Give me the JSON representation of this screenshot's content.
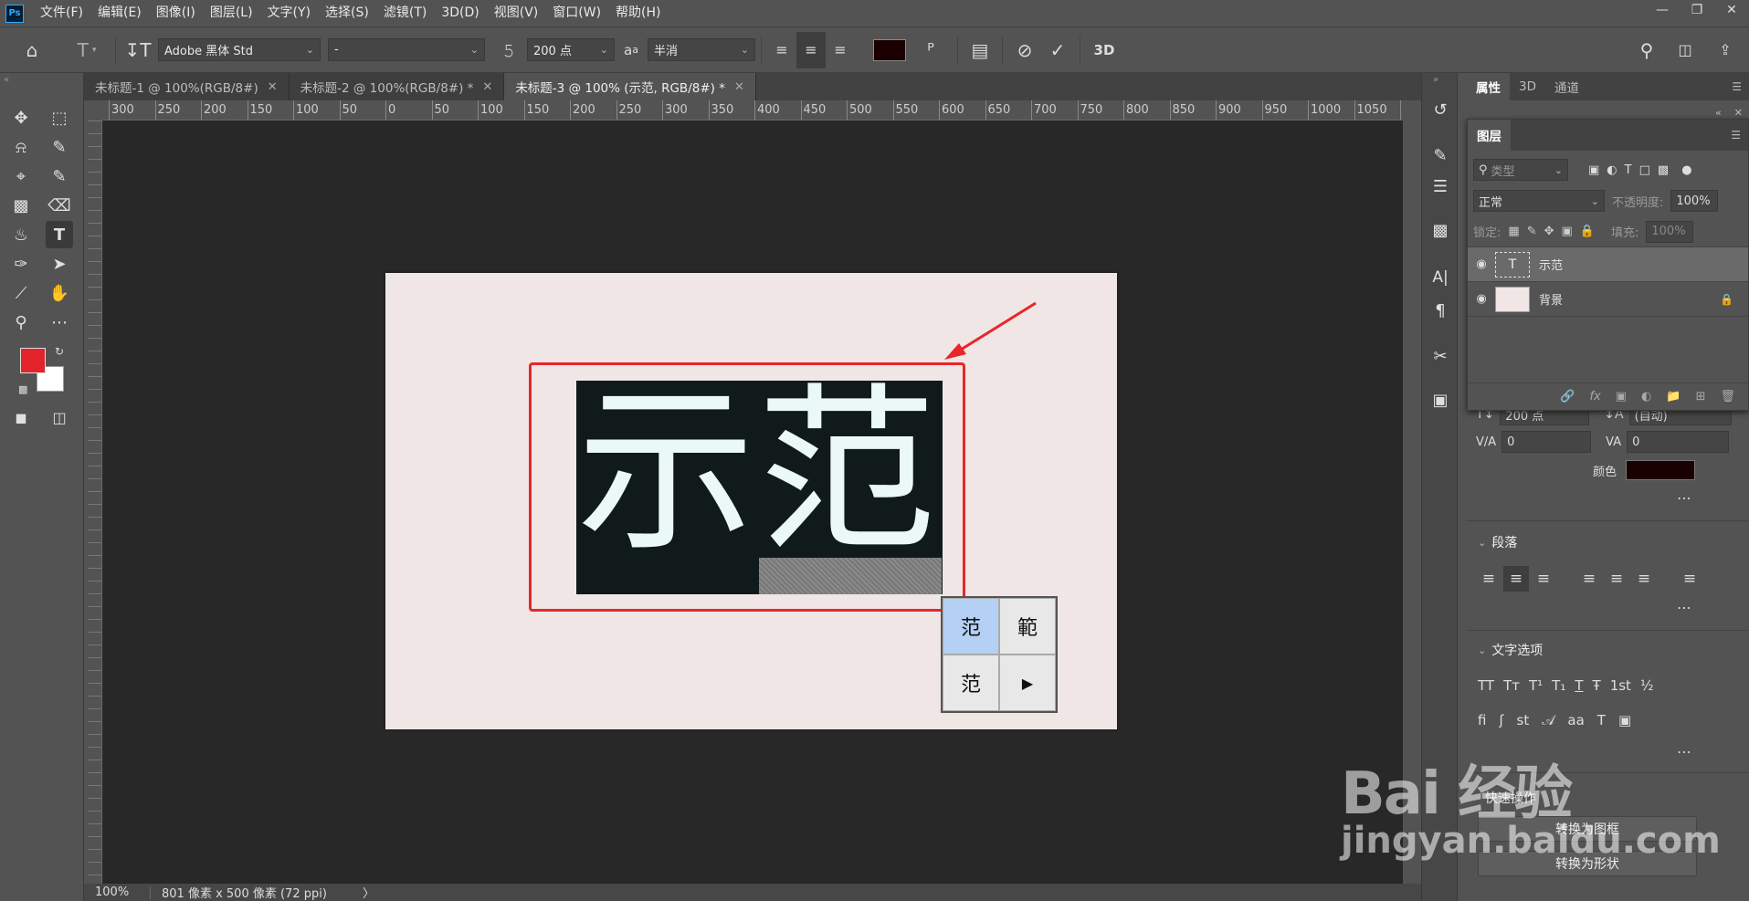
{
  "app": {
    "logo": "Ps"
  },
  "menu": [
    "文件(F)",
    "编辑(E)",
    "图像(I)",
    "图层(L)",
    "文字(Y)",
    "选择(S)",
    "滤镜(T)",
    "3D(D)",
    "视图(V)",
    "窗口(W)",
    "帮助(H)"
  ],
  "options": {
    "font_family": "Adobe 黑体 Std",
    "font_style": "-",
    "font_size": "200 点",
    "antialias": "半消",
    "text_color": "#1a0000"
  },
  "tabs": [
    {
      "label": "未标题-1 @ 100%(RGB/8#)",
      "active": false
    },
    {
      "label": "未标题-2 @ 100%(RGB/8#) *",
      "active": false
    },
    {
      "label": "未标题-3 @ 100% (示范, RGB/8#) *",
      "active": true
    }
  ],
  "ruler_h": [
    "300",
    "250",
    "200",
    "150",
    "100",
    "50",
    "0",
    "50",
    "100",
    "150",
    "200",
    "250",
    "300",
    "350",
    "400",
    "450",
    "500",
    "550",
    "600",
    "650",
    "700",
    "750",
    "800",
    "850",
    "900",
    "950",
    "1000",
    "1050",
    "1"
  ],
  "canvas": {
    "text": "示范",
    "doc_color": "#efe6e5",
    "text_bg": "#111a1a"
  },
  "ime": {
    "candidates": [
      "范",
      "範",
      "范"
    ],
    "next": "▶"
  },
  "status": {
    "zoom": "100%",
    "doc_info": "801 像素 x 500 像素 (72 ppi)",
    "arrow": "〉"
  },
  "panel_tabs": [
    "属性",
    "3D",
    "通道"
  ],
  "layers": {
    "tab": "图层",
    "filter_placeholder": "类型",
    "blend_mode": "正常",
    "opacity_label": "不透明度:",
    "opacity": "100%",
    "lock_label": "锁定:",
    "fill_label": "填充:",
    "fill": "100%",
    "items": [
      {
        "name": "示范",
        "type": "text",
        "selected": true
      },
      {
        "name": "背景",
        "type": "image",
        "selected": false
      }
    ]
  },
  "char": {
    "size": "200 点",
    "leading": "(自动)",
    "kerning": "0",
    "tracking": "0",
    "color_label": "颜色"
  },
  "paragraph": {
    "title": "段落"
  },
  "text_options": {
    "title": "文字选项",
    "glyphs": [
      "TT",
      "Tт",
      "T¹",
      "T₁",
      "T",
      "Ŧ",
      "1st",
      "½"
    ]
  },
  "quick_actions": {
    "title": "快速操作",
    "convert_frame": "转换为图框",
    "convert_shape": "转换为形状"
  },
  "watermark": {
    "brand": "Bai 经验",
    "url": "jingyan.baidu.com"
  }
}
